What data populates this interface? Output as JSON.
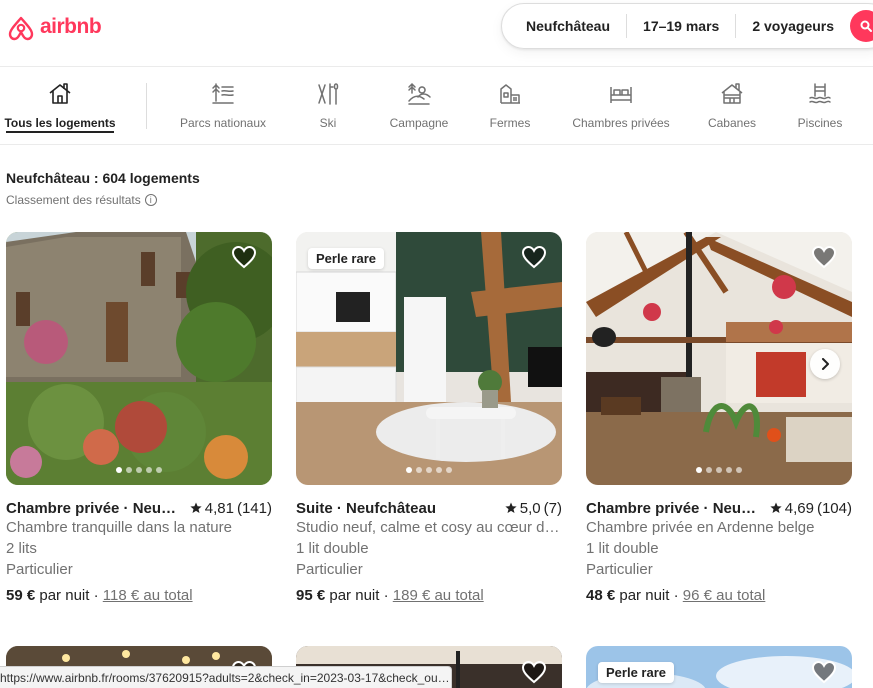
{
  "brand": {
    "name": "airbnb",
    "color": "#ff385c"
  },
  "search": {
    "location": "Neufchâteau",
    "dates": "17–19 mars",
    "guests": "2 voyageurs"
  },
  "categories": [
    {
      "label": "Tous les logements",
      "icon": "house-icon",
      "active": true
    },
    {
      "label": "Parcs nationaux",
      "icon": "national-park-icon",
      "active": false
    },
    {
      "label": "Ski",
      "icon": "ski-icon",
      "active": false
    },
    {
      "label": "Campagne",
      "icon": "countryside-icon",
      "active": false
    },
    {
      "label": "Fermes",
      "icon": "farm-icon",
      "active": false
    },
    {
      "label": "Chambres privées",
      "icon": "bed-icon",
      "active": false
    },
    {
      "label": "Cabanes",
      "icon": "cabin-icon",
      "active": false
    },
    {
      "label": "Piscines",
      "icon": "pool-icon",
      "active": false
    }
  ],
  "results": {
    "title": "Neufchâteau : 604 logements",
    "sort_label": "Classement des résultats"
  },
  "listings": [
    {
      "title": "Chambre privée · Neufchâteau",
      "rating": "4,81",
      "reviews": "(141)",
      "description": "Chambre tranquille dans la nature",
      "beds": "2 lits",
      "host": "Particulier",
      "price": "59 €",
      "per_night": "par nuit",
      "total": "118 € au total",
      "badge": "",
      "photo_dots": 5
    },
    {
      "title": "Suite · Neufchâteau",
      "rating": "5,0",
      "reviews": "(7)",
      "description": "Studio neuf, calme et cosy au cœur de la nature",
      "beds": "1 lit double",
      "host": "Particulier",
      "price": "95 €",
      "per_night": "par nuit",
      "total": "189 € au total",
      "badge": "Perle rare",
      "photo_dots": 5
    },
    {
      "title": "Chambre privée · Neufchâteau",
      "rating": "4,69",
      "reviews": "(104)",
      "description": "Chambre privée en Ardenne belge",
      "beds": "1 lit double",
      "host": "Particulier",
      "price": "48 €",
      "per_night": "par nuit",
      "total": "96 € au total",
      "badge": "",
      "photo_dots": 5
    }
  ],
  "bottom_row": [
    {
      "badge": ""
    },
    {
      "badge": ""
    },
    {
      "badge": "Perle rare"
    }
  ],
  "status_url": "https://www.airbnb.fr/rooms/37620915?adults=2&check_in=2023-03-17&check_out=2023-03-19"
}
